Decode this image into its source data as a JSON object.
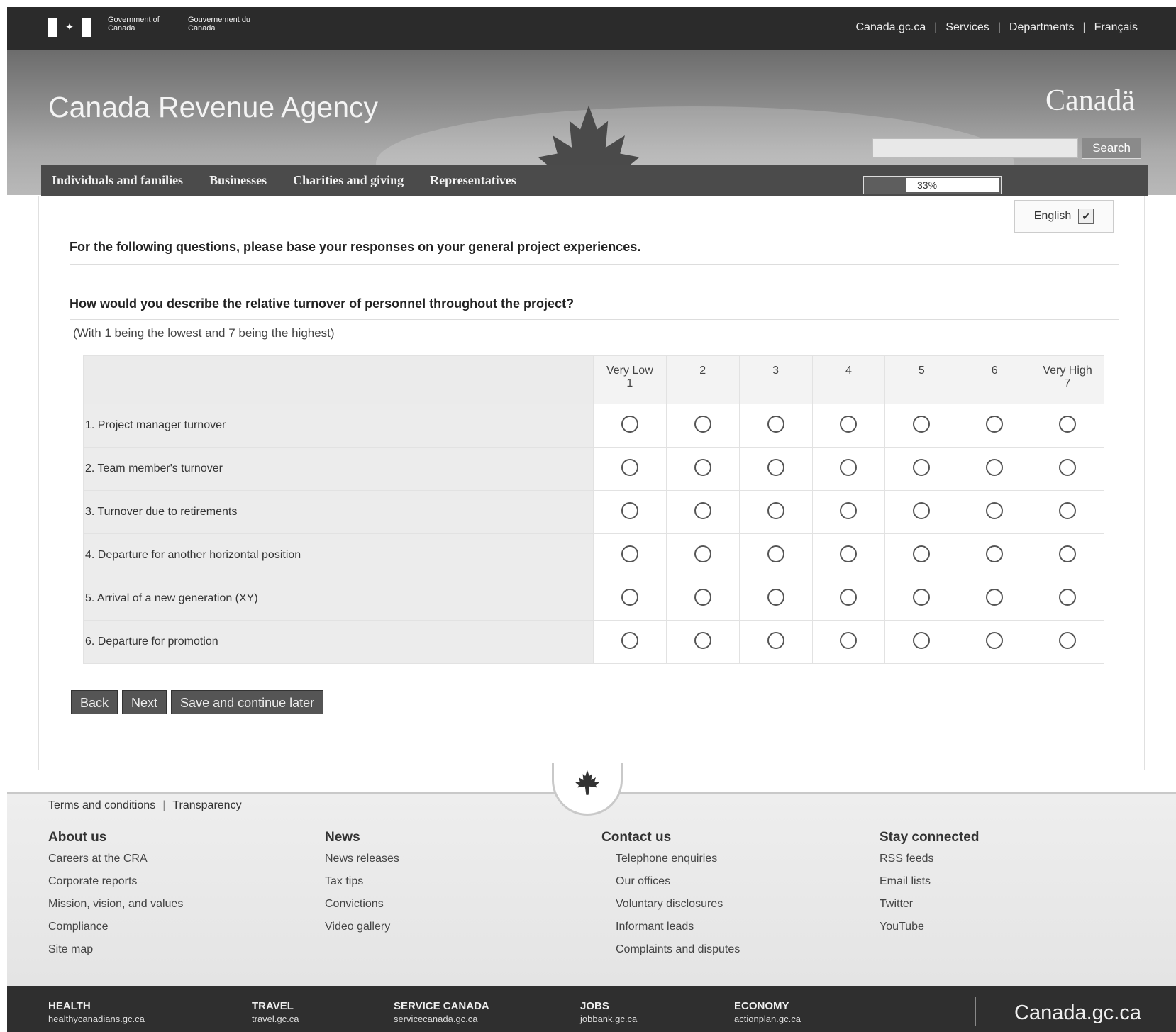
{
  "fip": {
    "gov_en": "Government of Canada",
    "gov_fr": "Gouvernement du Canada",
    "links": [
      "Canada.gc.ca",
      "Services",
      "Departments",
      "Français"
    ]
  },
  "banner": {
    "agency": "Canada Revenue Agency",
    "wordmark": "Canadä",
    "search_placeholder": "",
    "search_button": "Search"
  },
  "nav": {
    "items": [
      "Individuals and families",
      "Businesses",
      "Charities and giving",
      "Representatives"
    ]
  },
  "progress": {
    "value": 33,
    "label": "33%"
  },
  "language": {
    "selected": "English"
  },
  "survey": {
    "intro": "For the following questions, please base your responses on your general project experiences.",
    "question": "How would you describe the relative turnover of personnel throughout the project?",
    "hint": "(With 1 being the lowest and 7 being the highest)",
    "scale_headers": [
      {
        "top": "Very Low",
        "bottom": "1"
      },
      {
        "top": "2",
        "bottom": ""
      },
      {
        "top": "3",
        "bottom": ""
      },
      {
        "top": "4",
        "bottom": ""
      },
      {
        "top": "5",
        "bottom": ""
      },
      {
        "top": "6",
        "bottom": ""
      },
      {
        "top": "Very High",
        "bottom": "7"
      }
    ],
    "rows": [
      "1. Project manager turnover",
      "2. Team member's turnover",
      "3. Turnover due to retirements",
      "4. Departure for another horizontal position",
      "5. Arrival of a new generation (XY)",
      "6. Departure for promotion"
    ]
  },
  "buttons": {
    "back": "Back",
    "next": "Next",
    "save": "Save and continue later"
  },
  "footer": {
    "terms": "Terms and conditions",
    "transparency": "Transparency",
    "columns": [
      {
        "title": "About us",
        "links": [
          "Careers at the CRA",
          "Corporate reports",
          "Mission, vision, and values",
          "Compliance",
          "Site map"
        ]
      },
      {
        "title": "News",
        "links": [
          "News releases",
          "Tax tips",
          "Convictions",
          "Video gallery"
        ]
      },
      {
        "title": "Contact us",
        "links": [
          "Telephone enquiries",
          "Our offices",
          "Voluntary disclosures",
          "Informant leads",
          "Complaints and disputes"
        ]
      },
      {
        "title": "Stay connected",
        "links": [
          "RSS feeds",
          "Email lists",
          "Twitter",
          "YouTube"
        ]
      }
    ],
    "bottom": [
      {
        "title": "HEALTH",
        "url": "healthycanadians.gc.ca"
      },
      {
        "title": "TRAVEL",
        "url": "travel.gc.ca"
      },
      {
        "title": "SERVICE CANADA",
        "url": "servicecanada.gc.ca"
      },
      {
        "title": "JOBS",
        "url": "jobbank.gc.ca"
      },
      {
        "title": "ECONOMY",
        "url": "actionplan.gc.ca"
      }
    ],
    "canada_gc": "Canada.gc.ca"
  },
  "colors": {
    "fip_bg": "#2b2b2b",
    "nav_bg": "#4b4b4b",
    "button_bg": "#555555"
  }
}
